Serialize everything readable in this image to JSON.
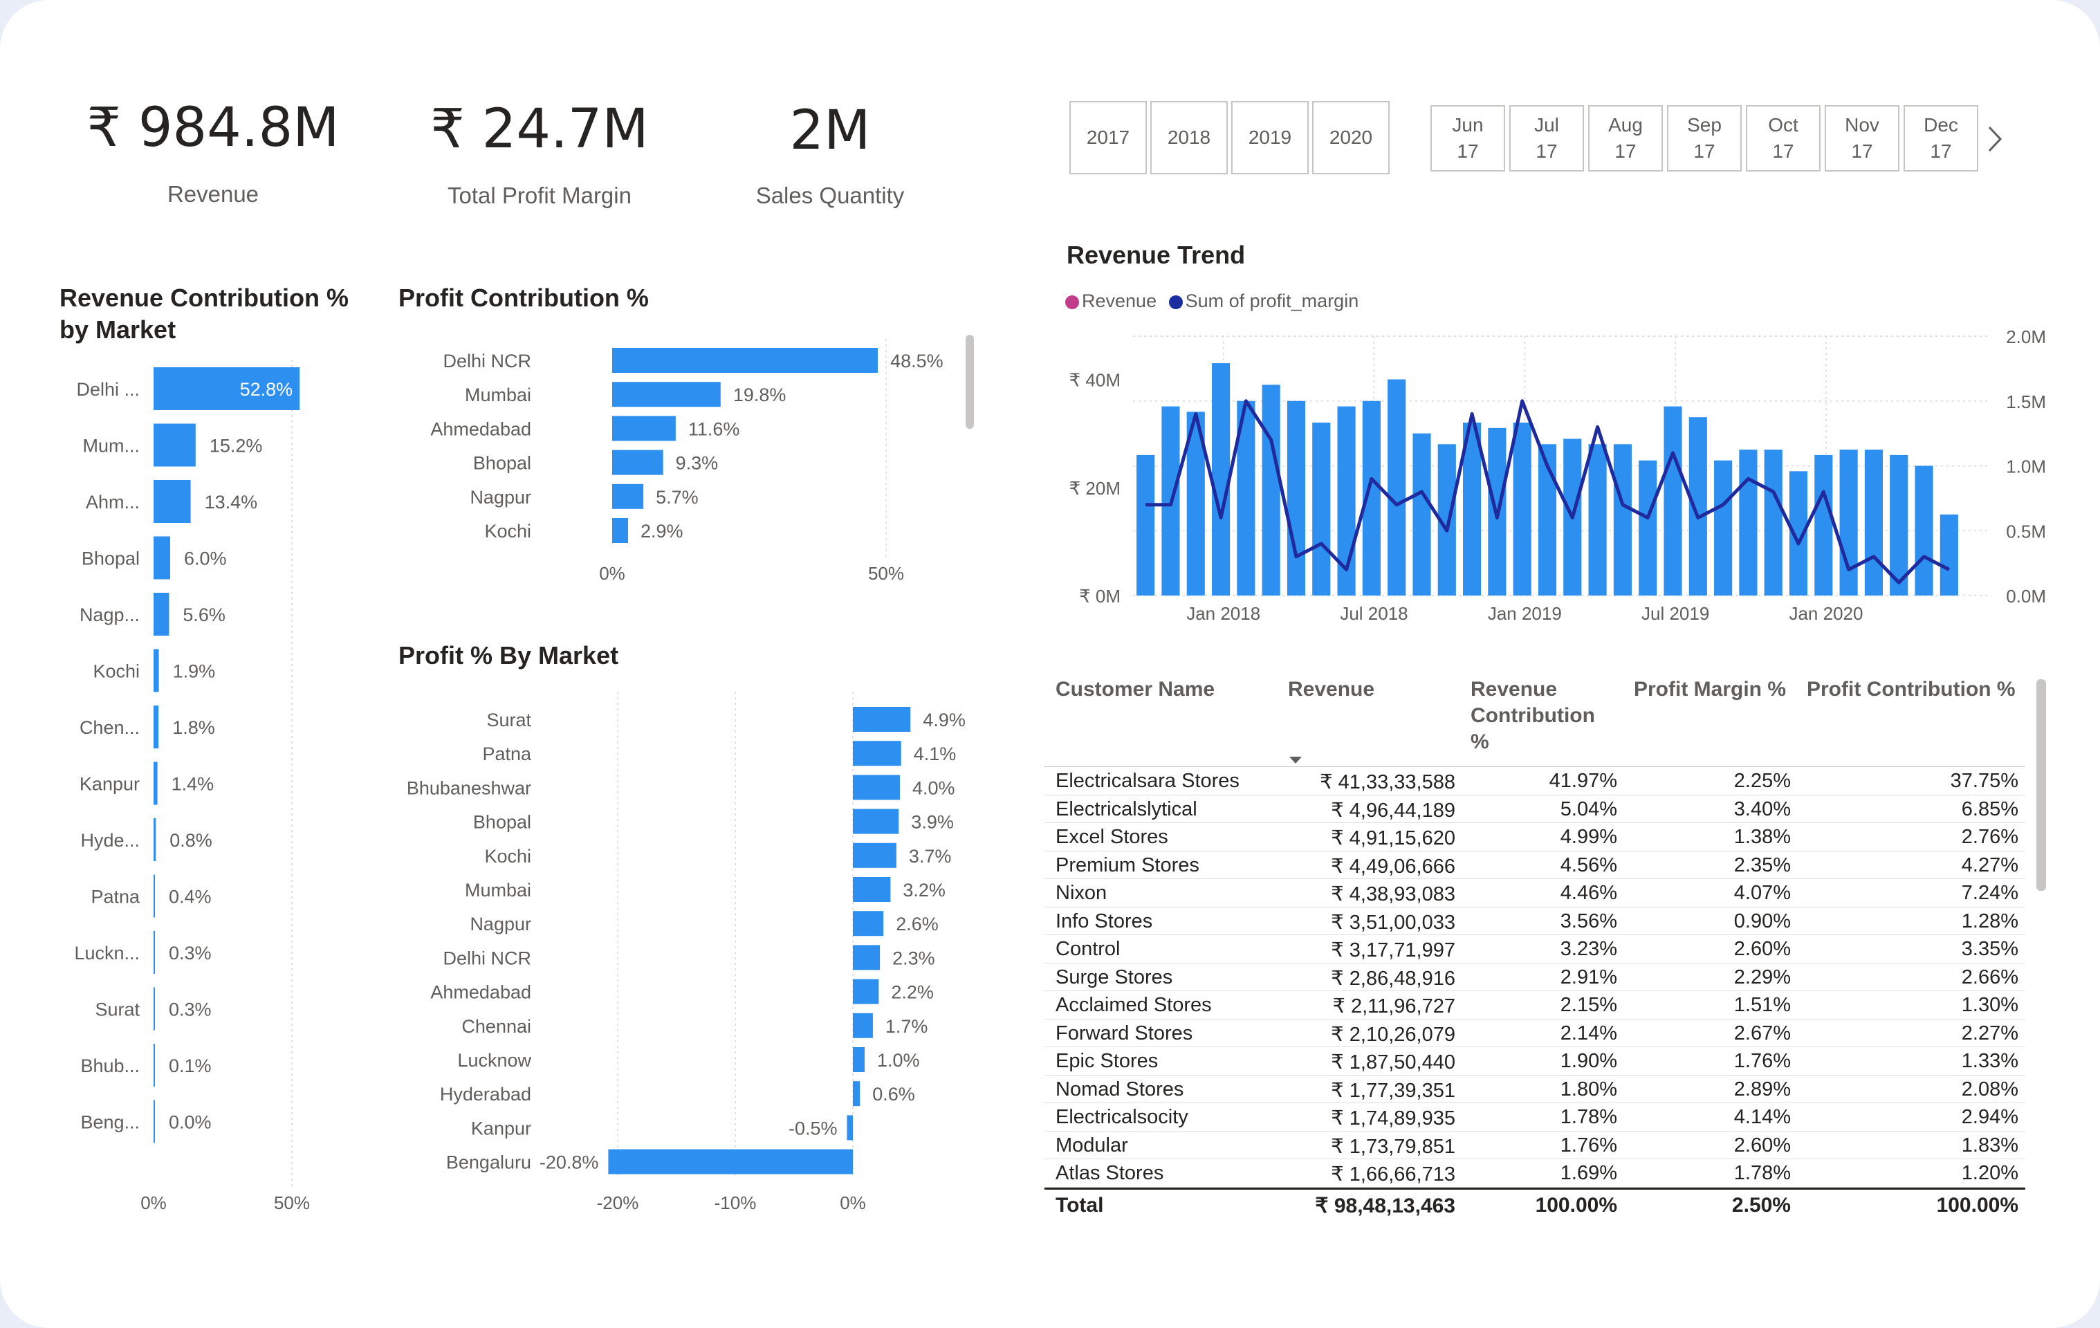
{
  "kpis": [
    {
      "value": "₹ 984.8M",
      "label": "Revenue"
    },
    {
      "value": "₹ 24.7M",
      "label": "Total Profit Margin"
    },
    {
      "value": "2M",
      "label": "Sales Quantity"
    }
  ],
  "year_slicer": [
    "2017",
    "2018",
    "2019",
    "2020"
  ],
  "month_slicer": [
    {
      "m": "Jun",
      "y": "17"
    },
    {
      "m": "Jul",
      "y": "17"
    },
    {
      "m": "Aug",
      "y": "17"
    },
    {
      "m": "Sep",
      "y": "17"
    },
    {
      "m": "Oct",
      "y": "17"
    },
    {
      "m": "Nov",
      "y": "17"
    },
    {
      "m": "Dec",
      "y": "17"
    }
  ],
  "icons": {
    "next": "chevron-right-icon"
  },
  "colors": {
    "bar": "#2d8ff0",
    "line": "#1f2a9c",
    "revenue_legend": "#c13d89",
    "profit_legend": "#1a2ea0"
  },
  "revenue_contribution": {
    "title": "Revenue Contribution %",
    "title2": "by Market",
    "type": "bar",
    "categories": [
      "Delhi ...",
      "Mum...",
      "Ahm...",
      "Bhopal",
      "Nagp...",
      "Kochi",
      "Chen...",
      "Kanpur",
      "Hyde...",
      "Patna",
      "Luckn...",
      "Surat",
      "Bhub...",
      "Beng..."
    ],
    "values": [
      52.8,
      15.2,
      13.4,
      6.0,
      5.6,
      1.9,
      1.8,
      1.4,
      0.8,
      0.4,
      0.3,
      0.3,
      0.1,
      0.0
    ],
    "labels": [
      "52.8%",
      "15.2%",
      "13.4%",
      "6.0%",
      "5.6%",
      "1.9%",
      "1.8%",
      "1.4%",
      "0.8%",
      "0.4%",
      "0.3%",
      "0.3%",
      "0.1%",
      "0.0%"
    ],
    "xticks": [
      "0%",
      "50%"
    ]
  },
  "profit_contribution": {
    "title": "Profit Contribution %",
    "type": "bar",
    "categories": [
      "Delhi NCR",
      "Mumbai",
      "Ahmedabad",
      "Bhopal",
      "Nagpur",
      "Kochi"
    ],
    "values": [
      48.5,
      19.8,
      11.6,
      9.3,
      5.7,
      2.9
    ],
    "labels": [
      "48.5%",
      "19.8%",
      "11.6%",
      "9.3%",
      "5.7%",
      "2.9%"
    ],
    "xticks": [
      "0%",
      "50%"
    ]
  },
  "profit_by_market": {
    "title": "Profit % By Market",
    "type": "bar",
    "categories": [
      "Surat",
      "Patna",
      "Bhubaneshwar",
      "Bhopal",
      "Kochi",
      "Mumbai",
      "Nagpur",
      "Delhi NCR",
      "Ahmedabad",
      "Chennai",
      "Lucknow",
      "Hyderabad",
      "Kanpur",
      "Bengaluru"
    ],
    "values": [
      4.9,
      4.1,
      4.0,
      3.9,
      3.7,
      3.2,
      2.6,
      2.3,
      2.2,
      1.7,
      1.0,
      0.6,
      -0.5,
      -20.8
    ],
    "labels": [
      "4.9%",
      "4.1%",
      "4.0%",
      "3.9%",
      "3.7%",
      "3.2%",
      "2.6%",
      "2.3%",
      "2.2%",
      "1.7%",
      "1.0%",
      "0.6%",
      "-0.5%",
      "-20.8%"
    ],
    "xticks": [
      "-20%",
      "-10%",
      "0%"
    ]
  },
  "chart_data": {
    "type": "bar",
    "title": "Revenue Trend",
    "legend": [
      "Revenue",
      "Sum of profit_margin"
    ],
    "y_ticks_left": [
      "₹ 40M",
      "₹ 20M",
      "₹ 0M"
    ],
    "y_ticks_right": [
      "2.0M",
      "1.5M",
      "1.0M",
      "0.5M",
      "0.0M"
    ],
    "x_ticks": [
      "Jan 2018",
      "Jul 2018",
      "Jan 2019",
      "Jul 2019",
      "Jan 2020"
    ],
    "ylim_left": [
      0,
      48
    ],
    "ylim_right": [
      0,
      2.0
    ],
    "series": [
      {
        "name": "Revenue",
        "type": "bar",
        "values": [
          26,
          35,
          34,
          43,
          36,
          39,
          36,
          32,
          35,
          36,
          40,
          30,
          28,
          32,
          31,
          32,
          28,
          29,
          28,
          28,
          25,
          35,
          33,
          25,
          27,
          27,
          23,
          26,
          27,
          27,
          26,
          24,
          15
        ]
      },
      {
        "name": "Sum of profit_margin",
        "type": "line",
        "values": [
          0.7,
          0.7,
          1.4,
          0.6,
          1.5,
          1.2,
          0.3,
          0.4,
          0.2,
          0.9,
          0.7,
          0.8,
          0.5,
          1.4,
          0.6,
          1.5,
          1.0,
          0.6,
          1.3,
          0.7,
          0.6,
          1.1,
          0.6,
          0.7,
          0.9,
          0.8,
          0.4,
          0.8,
          0.2,
          0.3,
          0.1,
          0.3,
          0.2
        ]
      }
    ]
  },
  "table": {
    "headers": [
      "Customer Name",
      "Revenue",
      "Revenue",
      "Contribution",
      "%",
      "Profit Margin %",
      "Profit Contribution %"
    ],
    "rows": [
      [
        "Electricalsara Stores",
        "₹ 41,33,33,588",
        "41.97%",
        "2.25%",
        "37.75%"
      ],
      [
        "Electricalslytical",
        "₹ 4,96,44,189",
        "5.04%",
        "3.40%",
        "6.85%"
      ],
      [
        "Excel Stores",
        "₹ 4,91,15,620",
        "4.99%",
        "1.38%",
        "2.76%"
      ],
      [
        "Premium Stores",
        "₹ 4,49,06,666",
        "4.56%",
        "2.35%",
        "4.27%"
      ],
      [
        "Nixon",
        "₹ 4,38,93,083",
        "4.46%",
        "4.07%",
        "7.24%"
      ],
      [
        "Info Stores",
        "₹ 3,51,00,033",
        "3.56%",
        "0.90%",
        "1.28%"
      ],
      [
        "Control",
        "₹ 3,17,71,997",
        "3.23%",
        "2.60%",
        "3.35%"
      ],
      [
        "Surge Stores",
        "₹ 2,86,48,916",
        "2.91%",
        "2.29%",
        "2.66%"
      ],
      [
        "Acclaimed Stores",
        "₹ 2,11,96,727",
        "2.15%",
        "1.51%",
        "1.30%"
      ],
      [
        "Forward Stores",
        "₹ 2,10,26,079",
        "2.14%",
        "2.67%",
        "2.27%"
      ],
      [
        "Epic Stores",
        "₹ 1,87,50,440",
        "1.90%",
        "1.76%",
        "1.33%"
      ],
      [
        "Nomad Stores",
        "₹ 1,77,39,351",
        "1.80%",
        "2.89%",
        "2.08%"
      ],
      [
        "Electricalsocity",
        "₹ 1,74,89,935",
        "1.78%",
        "4.14%",
        "2.94%"
      ],
      [
        "Modular",
        "₹ 1,73,79,851",
        "1.76%",
        "2.60%",
        "1.83%"
      ],
      [
        "Atlas Stores",
        "₹ 1,66,66,713",
        "1.69%",
        "1.78%",
        "1.20%"
      ]
    ],
    "total": [
      "Total",
      "₹ 98,48,13,463",
      "100.00%",
      "2.50%",
      "100.00%"
    ]
  }
}
